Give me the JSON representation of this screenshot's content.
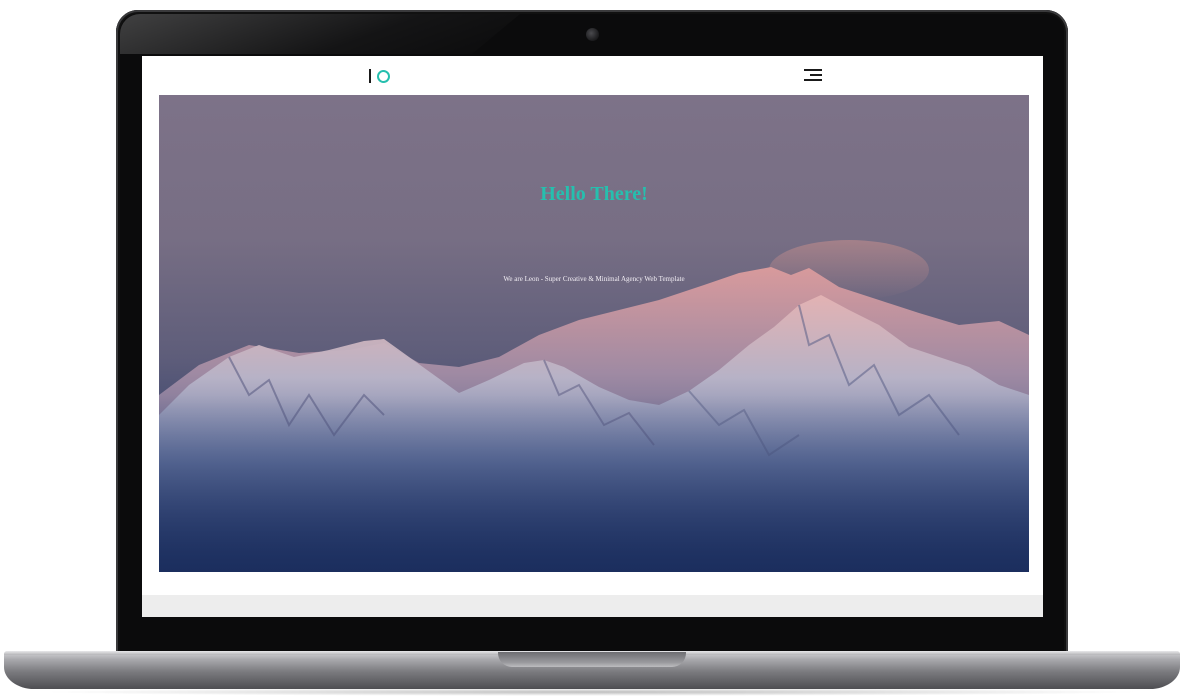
{
  "site": {
    "logo_alt": "IO",
    "hero_title": "Hello There!",
    "hero_subtitle": "We are Leon - Super Creative & Minimal Agency Web Template"
  },
  "icons": {
    "logo": "io-logo-icon",
    "menu": "hamburger-menu-icon",
    "camera": "camera-icon"
  },
  "colors": {
    "accent": "#26bfae",
    "bezel": "#0b0b0c",
    "sky": "#7d7288",
    "base_metal": "#a9a9ad"
  }
}
